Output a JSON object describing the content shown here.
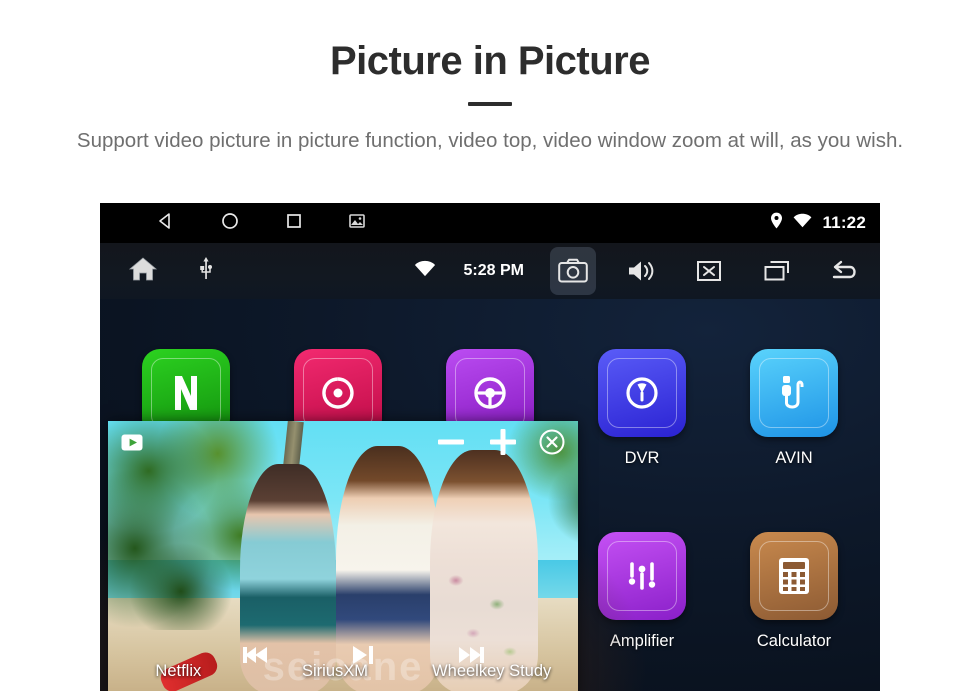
{
  "header": {
    "title": "Picture in Picture",
    "subtitle": "Support video picture in picture function, video top, video window zoom at will, as you wish."
  },
  "device": {
    "status_bar": {
      "nav": [
        {
          "name": "back-icon",
          "label": "Back"
        },
        {
          "name": "home-icon",
          "label": "Home"
        },
        {
          "name": "recents-icon",
          "label": "Recents"
        },
        {
          "name": "screenshot-icon",
          "label": "Screenshot"
        }
      ],
      "location_icon": "location-pin-icon",
      "wifi_icon": "wifi-icon",
      "time": "11:22"
    },
    "toolbar": {
      "home_icon": "home-icon",
      "usb_icon": "usb-icon",
      "wifi_icon": "wifi-icon",
      "clock": "5:28 PM",
      "buttons": [
        {
          "name": "camera-button",
          "label": "Camera",
          "active": true
        },
        {
          "name": "volume-button",
          "label": "Volume",
          "active": false
        },
        {
          "name": "close-app-button",
          "label": "Close",
          "active": false
        },
        {
          "name": "recent-apps-button",
          "label": "Recent apps",
          "active": false
        },
        {
          "name": "back-button",
          "label": "Back",
          "active": false
        }
      ]
    },
    "apps": [
      {
        "label": "Netflix",
        "icon": "netflix-icon",
        "color": "#1db817",
        "color2": "#13990f"
      },
      {
        "label": "SiriusXM",
        "icon": "siriusxm-icon",
        "color": "#e3185e",
        "color2": "#c00f4a"
      },
      {
        "label": "Wheelkey Study",
        "icon": "wheelkey-icon",
        "color": "#a630e0",
        "color2": "#8a1dc4"
      },
      {
        "label": "DVR",
        "icon": "dvr-icon",
        "color": "#4a4ef2",
        "color2": "#2b25d6"
      },
      {
        "label": "AVIN",
        "icon": "avin-icon",
        "color": "#4ec8fb",
        "color2": "#1f9bea"
      },
      {
        "label": "",
        "icon": "",
        "color": "",
        "color2": ""
      },
      {
        "label": "",
        "icon": "",
        "color": "",
        "color2": ""
      },
      {
        "label": "",
        "icon": "",
        "color": "",
        "color2": ""
      },
      {
        "label": "Amplifier",
        "icon": "amplifier-icon",
        "color": "#b23ee8",
        "color2": "#8a1fc9"
      },
      {
        "label": "Calculator",
        "icon": "calculator-icon",
        "color": "#b3seventy",
        "color2": "#8c5a33"
      }
    ],
    "pip": {
      "source_icon": "video-camera-play-icon",
      "controls": [
        {
          "name": "zoom-out-button",
          "label": "Shrink window",
          "glyph": "minus"
        },
        {
          "name": "zoom-in-button",
          "label": "Enlarge window",
          "glyph": "plus"
        },
        {
          "name": "close-pip-button",
          "label": "Close window",
          "glyph": "circle-x"
        }
      ],
      "transport": [
        {
          "name": "previous-track-button",
          "label": "Previous"
        },
        {
          "name": "play-pause-button",
          "label": "Play / Pause"
        },
        {
          "name": "next-track-button",
          "label": "Next"
        }
      ],
      "watermark": "seicane"
    },
    "bottom_labels": [
      "Netflix",
      "SiriusXM",
      "Wheelkey Study"
    ]
  }
}
